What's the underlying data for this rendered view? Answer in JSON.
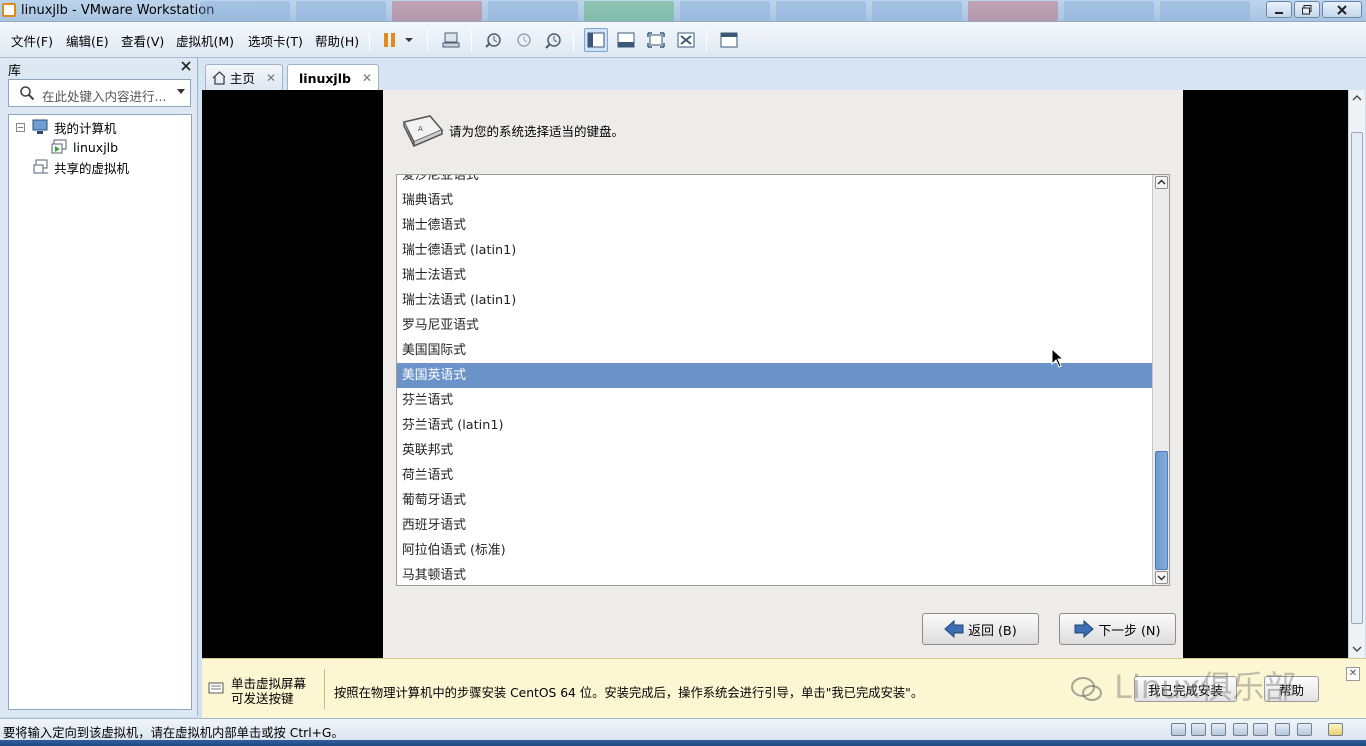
{
  "window": {
    "title": "linuxjlb - VMware Workstation"
  },
  "menu": [
    "文件(F)",
    "编辑(E)",
    "查看(V)",
    "虚拟机(M)",
    "选项卡(T)",
    "帮助(H)"
  ],
  "library": {
    "header": "库",
    "search_placeholder": "在此处键入内容进行...",
    "tree": {
      "my_computer": "我的计算机",
      "vm": "linuxjlb",
      "shared": "共享的虚拟机"
    }
  },
  "tabs": [
    {
      "label": "主页",
      "icon": "home-icon"
    },
    {
      "label": "linuxjlb",
      "icon": "vm-icon"
    }
  ],
  "installer": {
    "prompt": "请为您的系统选择适当的键盘。",
    "keyboards": [
      "爱沙尼亚语式",
      "瑞典语式",
      "瑞士德语式",
      "瑞士德语式 (latin1)",
      "瑞士法语式",
      "瑞士法语式 (latin1)",
      "罗马尼亚语式",
      "美国国际式",
      "美国英语式",
      "芬兰语式",
      "芬兰语式 (latin1)",
      "英联邦式",
      "荷兰语式",
      "葡萄牙语式",
      "西班牙语式",
      "阿拉伯语式 (标准)",
      "马其顿语式"
    ],
    "selected": "美国英语式",
    "back_button": "返回 (B)",
    "next_button": "下一步 (N)"
  },
  "hint": {
    "left_line1": "单击虚拟屏幕",
    "left_line2": "可发送按键",
    "message": "按照在物理计算机中的步骤安装 CentOS 64 位。安装完成后，操作系统会进行引导，单击\"我已完成安装\"。",
    "done_button": "我已完成安装",
    "help_button": "帮助",
    "watermark": "Linux俱乐部"
  },
  "status": {
    "text": "要将输入定向到该虚拟机，请在虚拟机内部单击或按 Ctrl+G。"
  },
  "colors": {
    "accent_selection": "#6b93c9",
    "hint_background": "#fdf6d2",
    "chrome": "#dde8f4"
  }
}
